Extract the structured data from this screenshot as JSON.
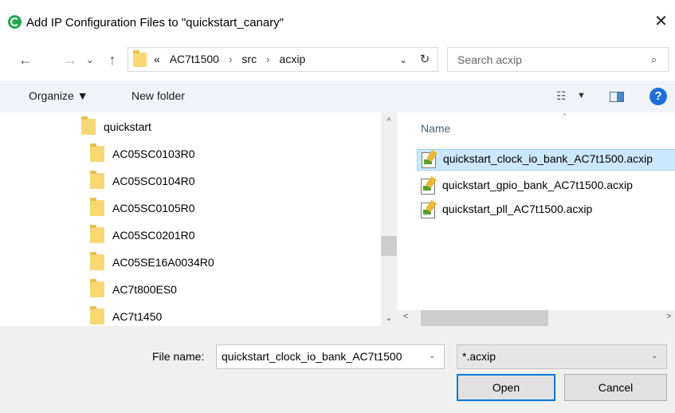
{
  "window": {
    "title": "Add IP Configuration Files to \"quickstart_canary\"",
    "close_glyph": "✕"
  },
  "nav": {
    "back_glyph": "←",
    "forward_glyph": "→",
    "recent_glyph": "⌄",
    "up_glyph": "↑"
  },
  "address": {
    "prefix": "«",
    "crumbs": [
      "AC7t1500",
      "src",
      "acxip"
    ],
    "separator": "›",
    "dropdown_glyph": "⌄",
    "refresh_glyph": "↻"
  },
  "search": {
    "placeholder": "Search acxip",
    "icon_glyph": "⌕"
  },
  "toolbar": {
    "organize_label": "Organize ▼",
    "new_folder_label": "New folder",
    "view_glyph": "☷",
    "view_dropdown_glyph": "▼",
    "help_glyph": "?"
  },
  "tree": {
    "items": [
      {
        "label": "quickstart"
      },
      {
        "label": "AC05SC0103R0"
      },
      {
        "label": "AC05SC0104R0"
      },
      {
        "label": "AC05SC0105R0"
      },
      {
        "label": "AC05SC0201R0"
      },
      {
        "label": "AC05SE16A0034R0"
      },
      {
        "label": "AC7t800ES0"
      },
      {
        "label": "AC7t1450"
      }
    ],
    "scroll_up_glyph": "^",
    "scroll_down_glyph": "⌄"
  },
  "filelist": {
    "sort_glyph": "^",
    "column_name": "Name",
    "files": [
      {
        "name": "quickstart_clock_io_bank_AC7t1500.acxip",
        "selected": true
      },
      {
        "name": "quickstart_gpio_bank_AC7t1500.acxip",
        "selected": false
      },
      {
        "name": "quickstart_pll_AC7t1500.acxip",
        "selected": false
      }
    ],
    "scroll_left_glyph": "<",
    "scroll_right_glyph": ">"
  },
  "bottom": {
    "file_name_label": "File name:",
    "file_name_value": "quickstart_clock_io_bank_AC7t1500",
    "file_name_dropdown_glyph": "⌄",
    "filter_value": "*.acxip",
    "filter_dropdown_glyph": "⌄",
    "open_label": "Open",
    "cancel_label": "Cancel"
  },
  "colors": {
    "accent": "#0078d7",
    "selection": "#cce8ff",
    "app_icon": "#1fa84f",
    "help_icon": "#1e6ed6"
  }
}
